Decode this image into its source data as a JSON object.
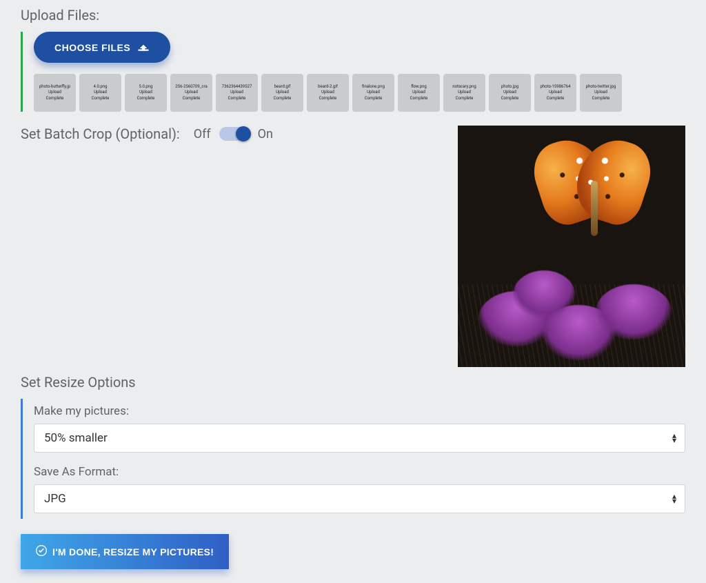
{
  "upload": {
    "title": "Upload Files:",
    "choose_label": "CHOOSE FILES",
    "status_line1": "Upload",
    "status_line2": "Complete",
    "files": [
      "photo-butterfly.jp",
      "4.0.png",
      "5.0.png",
      "256-2560709_cra",
      "7362364439527",
      "beard.gif",
      "beard-2.gif",
      "finalone.png",
      "flow.png",
      "notscary.png",
      "photo.jpg",
      "photo-15986764",
      "photo-twitter.jpg"
    ]
  },
  "crop": {
    "label": "Set Batch Crop (Optional):",
    "off": "Off",
    "on": "On",
    "state": "on"
  },
  "resize": {
    "title": "Set Resize Options",
    "size_label": "Make my pictures:",
    "size_value": "50% smaller",
    "format_label": "Save As Format:",
    "format_value": "JPG"
  },
  "submit": {
    "label": "I'M DONE, RESIZE MY PICTURES!"
  }
}
